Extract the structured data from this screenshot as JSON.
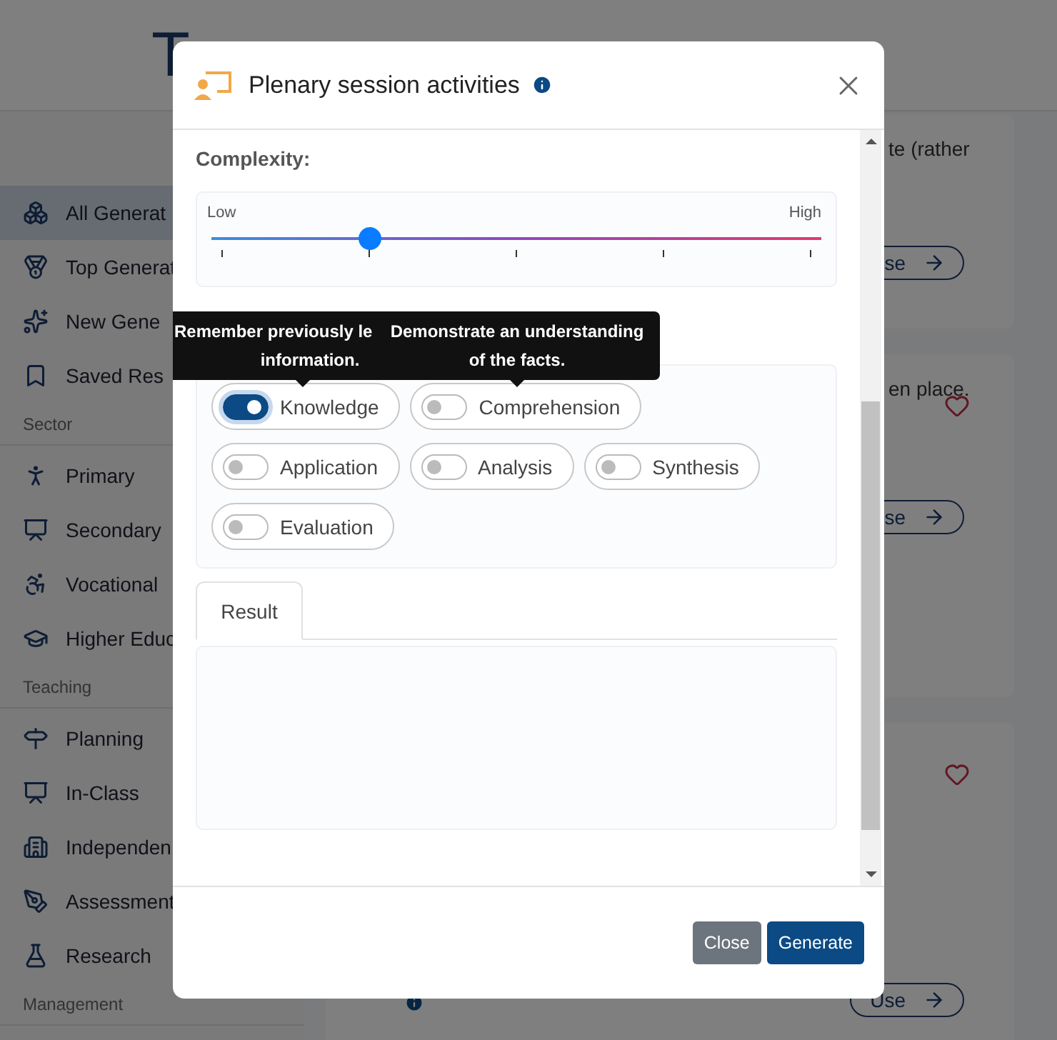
{
  "header": {
    "logo": "T"
  },
  "sidebar": {
    "groups": [
      {
        "items": [
          {
            "label": "All Generat",
            "selected": true
          },
          {
            "label": "Top Generat",
            "selected": false
          },
          {
            "label": "New Gene",
            "selected": false
          },
          {
            "label": "Saved Res",
            "selected": false
          }
        ]
      },
      {
        "heading": "Sector",
        "items": [
          {
            "label": "Primary",
            "selected": false
          },
          {
            "label": "Secondary",
            "selected": false
          },
          {
            "label": "Vocational",
            "selected": false
          },
          {
            "label": "Higher Educ",
            "selected": false
          }
        ]
      },
      {
        "heading": "Teaching",
        "items": [
          {
            "label": "Planning",
            "selected": false
          },
          {
            "label": "In-Class",
            "selected": false
          },
          {
            "label": "Independen",
            "selected": false
          },
          {
            "label": "Assessment",
            "selected": false
          },
          {
            "label": "Research",
            "selected": false
          }
        ]
      },
      {
        "heading": "Management"
      }
    ]
  },
  "cards": [
    {
      "text": "te (rather",
      "button": "se"
    },
    {
      "text": "en place.",
      "button": "se",
      "favourite": false
    },
    {
      "button": "Use",
      "favourite": false
    }
  ],
  "modal": {
    "title": "Plenary session activities",
    "complexity": {
      "label": "Complexity:",
      "low": "Low",
      "high": "High",
      "level": 0.26
    },
    "bloom": {
      "options": [
        {
          "label": "Knowledge",
          "on": true
        },
        {
          "label": "Comprehension",
          "on": false
        },
        {
          "label": "Application",
          "on": false
        },
        {
          "label": "Analysis",
          "on": false
        },
        {
          "label": "Synthesis",
          "on": false
        },
        {
          "label": "Evaluation",
          "on": false
        }
      ]
    },
    "tooltips": [
      {
        "lines": [
          "Remember previously le",
          "information."
        ]
      },
      {
        "lines": [
          "Demonstrate an understanding",
          "of the facts."
        ]
      }
    ],
    "tabs": [
      {
        "label": "Result",
        "selected": true
      }
    ],
    "buttons": [
      {
        "label": "Close",
        "kind": "secondary"
      },
      {
        "label": "Generate",
        "kind": "primary"
      }
    ]
  }
}
